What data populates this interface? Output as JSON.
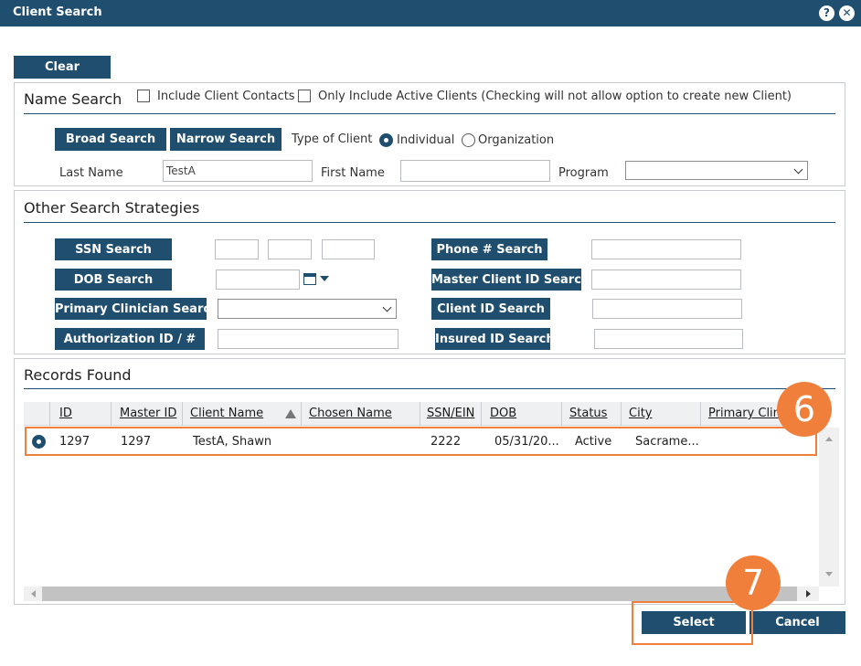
{
  "window": {
    "title": "Client Search",
    "help_icon": "question-icon",
    "close_icon": "close-icon"
  },
  "clear_label": "Clear",
  "name_search": {
    "title": "Name Search",
    "include_contacts": "Include Client Contacts",
    "only_active": "Only Include Active Clients (Checking will not allow option to create new Client)",
    "broad_label": "Broad Search",
    "narrow_label": "Narrow Search",
    "type_label": "Type of Client",
    "individual": "Individual",
    "organization": "Organization",
    "last_name_label": "Last Name",
    "last_name_value": "TestA",
    "first_name_label": "First Name",
    "first_name_value": "",
    "program_label": "Program",
    "program_value": ""
  },
  "other": {
    "title": "Other Search Strategies",
    "ssn": "SSN Search",
    "dob": "DOB Search",
    "primary_clinician": "Primary Clinician Search",
    "authorization": "Authorization ID / #",
    "phone": "Phone # Search",
    "master_id": "Master Client ID Search",
    "client_id": "Client ID Search",
    "insured_id": "Insured ID Search"
  },
  "records": {
    "title": "Records Found",
    "columns": [
      "ID",
      "Master ID",
      "Client Name",
      "Chosen Name",
      "SSN/EIN",
      "DOB",
      "Status",
      "City",
      "Primary Clin"
    ],
    "row": [
      "1297",
      "1297",
      "TestA, Shawn",
      "",
      "2222",
      "05/31/20...",
      "Active",
      "Sacrame...",
      ""
    ]
  },
  "select_label": "Select",
  "cancel_label": "Cancel",
  "callouts": {
    "a": "6",
    "b": "7"
  },
  "colors": {
    "header": "#1f4e6e",
    "accent": "#f07f3c"
  }
}
